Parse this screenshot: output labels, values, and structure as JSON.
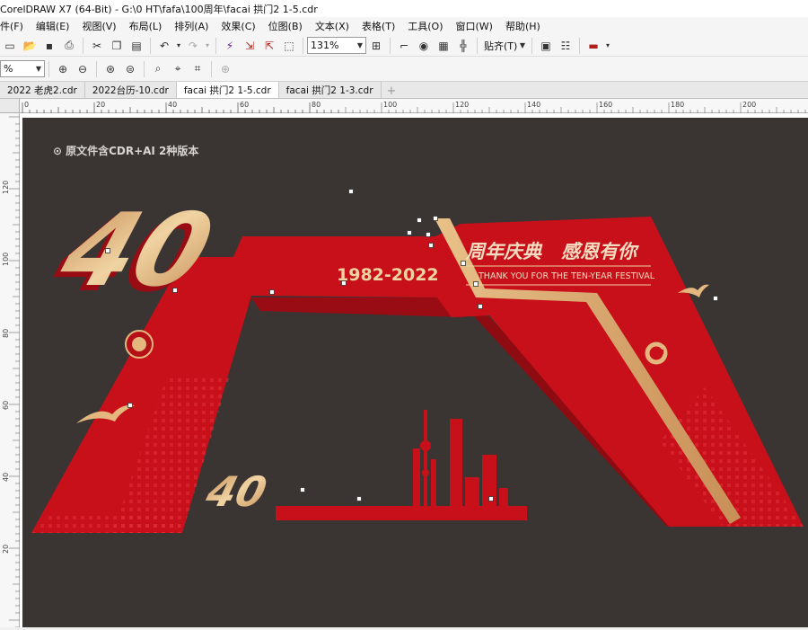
{
  "window": {
    "title": "CorelDRAW X7 (64-Bit) - G:\\0 HT\\fafa\\100周年\\facai 拱门2 1-5.cdr"
  },
  "menu": [
    "件(F)",
    "编辑(E)",
    "视图(V)",
    "布局(L)",
    "排列(A)",
    "效果(C)",
    "位图(B)",
    "文本(X)",
    "表格(T)",
    "工具(O)",
    "窗口(W)",
    "帮助(H)"
  ],
  "toolbar": {
    "zoom_value": "131%",
    "snap_label": "贴齐(T)",
    "zoom_small": "%"
  },
  "tabs": [
    "2022 老虎2.cdr",
    "2022台历-10.cdr",
    "facai 拱门2 1-5.cdr",
    "facai 拱门2 1-3.cdr"
  ],
  "active_tab": 2,
  "ruler": {
    "h_labels": [
      "0",
      "20",
      "40",
      "60",
      "80",
      "100",
      "120",
      "140",
      "160",
      "180",
      "200"
    ],
    "v_labels": [
      "120",
      "100",
      "80",
      "60",
      "40",
      "20"
    ]
  },
  "artwork": {
    "note": "原文件含CDR+AI 2种版本",
    "big_number": "40",
    "years": "1982-2022",
    "headline_a": "周年庆典",
    "headline_b": "感恩有你",
    "subline": "THANK YOU FOR THE TEN-YEAR FESTIVAL",
    "small_number": "40"
  },
  "colors": {
    "red": "#c8101a",
    "dark_red": "#9a0c14",
    "gold": "#d9a86a",
    "background": "#3a3533"
  }
}
